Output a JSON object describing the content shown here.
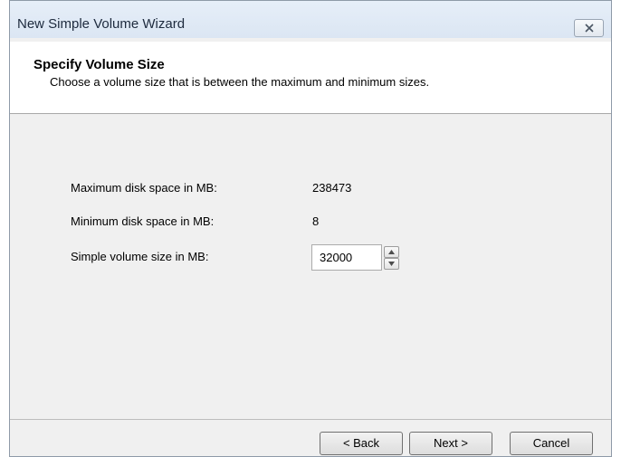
{
  "window": {
    "title": "New Simple Volume Wizard",
    "close_icon": "close-x-icon"
  },
  "header": {
    "title": "Specify Volume Size",
    "subtitle": "Choose a volume size that is between the maximum and minimum sizes."
  },
  "form": {
    "max_label": "Maximum disk space in MB:",
    "max_value": "238473",
    "min_label": "Minimum disk space in MB:",
    "min_value": "8",
    "size_label": "Simple volume size in MB:",
    "size_value": "32000",
    "spin_up_icon": "triangle-up-icon",
    "spin_down_icon": "triangle-down-icon"
  },
  "buttons": {
    "back": "< Back",
    "next": "Next >",
    "cancel": "Cancel"
  }
}
